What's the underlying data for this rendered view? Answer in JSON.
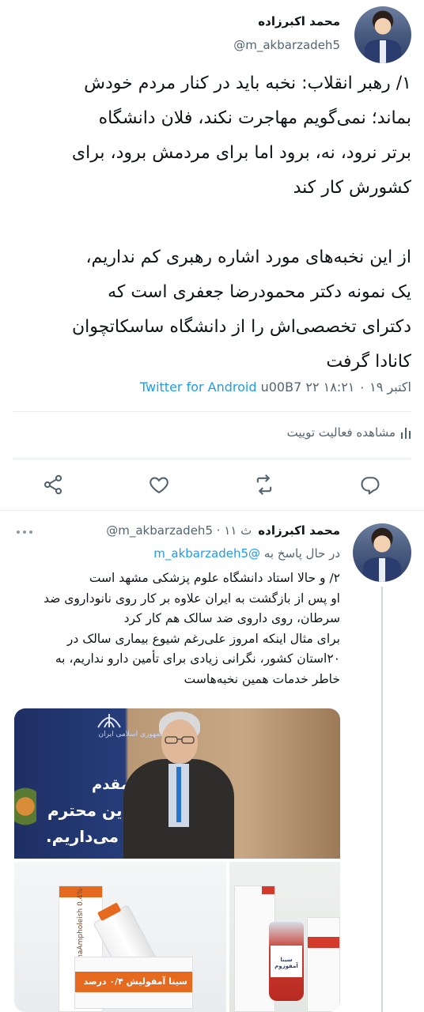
{
  "main_tweet": {
    "display_name": "محمد اکبرزاده",
    "handle": "@m_akbarzadeh5",
    "paragraph1": [
      "۱/ رهبر انقلاب: نخبه باید در کنار مردم خودش",
      "بماند؛ نمی‌گویم مهاجرت نکند، فلان دانشگاه",
      "برتر نرود، نه، برود اما برای مردمش برود، برای",
      "کشورش کار کند"
    ],
    "paragraph2": [
      "از این نخبه‌های مورد اشاره رهبری کم نداریم،",
      "یک نمونه دکتر محمودرضا جعفری است که",
      "دکترای تخصصی‌اش را از دانشگاه ساسکاتچوان",
      "کانادا گرفت"
    ],
    "source": "Twitter for Android",
    "timestamp": "u00B7 ۲۲ اکتبر ۱۹ ۰ ۱۸:۲۱",
    "activity_label": "مشاهده فعالیت توییت",
    "activity_icon": "bar-chart-icon",
    "actions": {
      "reply_icon": "reply-icon",
      "retweet_icon": "retweet-icon",
      "like_icon": "heart-icon",
      "share_icon": "share-icon"
    }
  },
  "reply_tweet": {
    "display_name": "محمد اکبرزاده",
    "handle_time": "@m_akbarzadeh5 · ۱۱ ث",
    "replying_to_label": "در حال پاسخ به",
    "replying_to_handle": "@m_akbarzadeh5",
    "lines": [
      "۲/ و حالا استاد دانشگاه علوم پزشکی مشهد است",
      "او پس از بازگشت به ایران علاوه بر کار روی نانوداروی ضد",
      "سرطان، روی داروی ضد سالک هم کار کرد",
      "برای مثال اینکه امروز علی‌رغم شیوع بیماری سالک در",
      "۲۰استان کشور، نگرانی زیادی برای تأمین دارو نداریم، به",
      "خاطر خدمات همین نخبه‌هاست"
    ],
    "more_icon": "more-dots-icon",
    "media": {
      "photo1_lines": [
        "مقدم",
        "ین محترم",
        "ی می‌داریم."
      ],
      "photo1_emblem_text": "جمهوری اسلامی ایران",
      "photo2_label": "سینا آمفولیش ۰/۴ درصد",
      "photo2_box_text": "SinaAmpholeish 0.4%",
      "photo3_label": "سینا آمفوزوم"
    }
  },
  "colors": {
    "link": "#1d9bf0",
    "secondary_text": "#536471",
    "divider": "#e6ecf0"
  }
}
